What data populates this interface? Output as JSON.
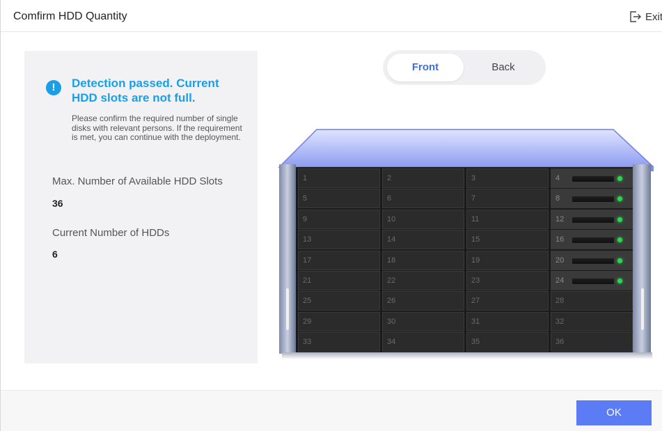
{
  "header": {
    "title": "Comfirm HDD Quantity",
    "exit_label": "Exit",
    "exit_icon": "exit-icon"
  },
  "panel": {
    "alert_icon": "info-icon",
    "alert_color": "#1a9ee8",
    "alert_title": "Detection passed. Current HDD slots are not full.",
    "alert_description": "Please confirm the required number of single disks with relevant persons. If the requirement is met, you can continue with the deployment.",
    "max_slots_label": "Max. Number of Available HDD Slots",
    "max_slots_value": "36",
    "current_hdds_label": "Current Number of HDDs",
    "current_hdds_value": "6"
  },
  "view_toggle": {
    "options": [
      "Front",
      "Back"
    ],
    "selected": "Front",
    "active_color": "#3c6fe0"
  },
  "chassis": {
    "slots": [
      "1",
      "2",
      "3",
      "4",
      "5",
      "6",
      "7",
      "8",
      "9",
      "10",
      "11",
      "12",
      "13",
      "14",
      "15",
      "16",
      "17",
      "18",
      "19",
      "20",
      "21",
      "22",
      "23",
      "24",
      "25",
      "26",
      "27",
      "28",
      "29",
      "30",
      "31",
      "32",
      "33",
      "34",
      "35",
      "36"
    ],
    "occupied_slots": [
      "4",
      "8",
      "12",
      "16",
      "20",
      "24"
    ],
    "led_color": "#27d84a"
  },
  "footer": {
    "ok_label": "OK",
    "ok_color": "#5b7cf5"
  }
}
